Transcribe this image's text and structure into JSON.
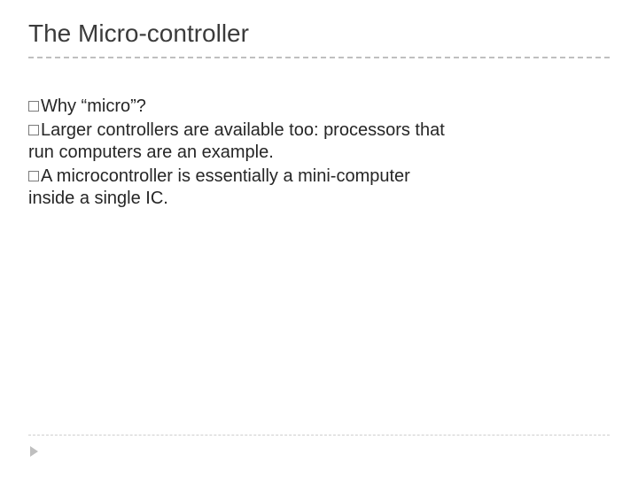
{
  "slide": {
    "title": "The Micro-controller",
    "bullets": [
      {
        "first": "Why",
        "rest": " “micro”?"
      },
      {
        "first": "Larger",
        "rest": " controllers are available too: processors that",
        "cont": "run computers are an example."
      },
      {
        "first": "A",
        "rest": " microcontroller is essentially a mini-computer",
        "cont": "inside a single IC."
      }
    ]
  }
}
